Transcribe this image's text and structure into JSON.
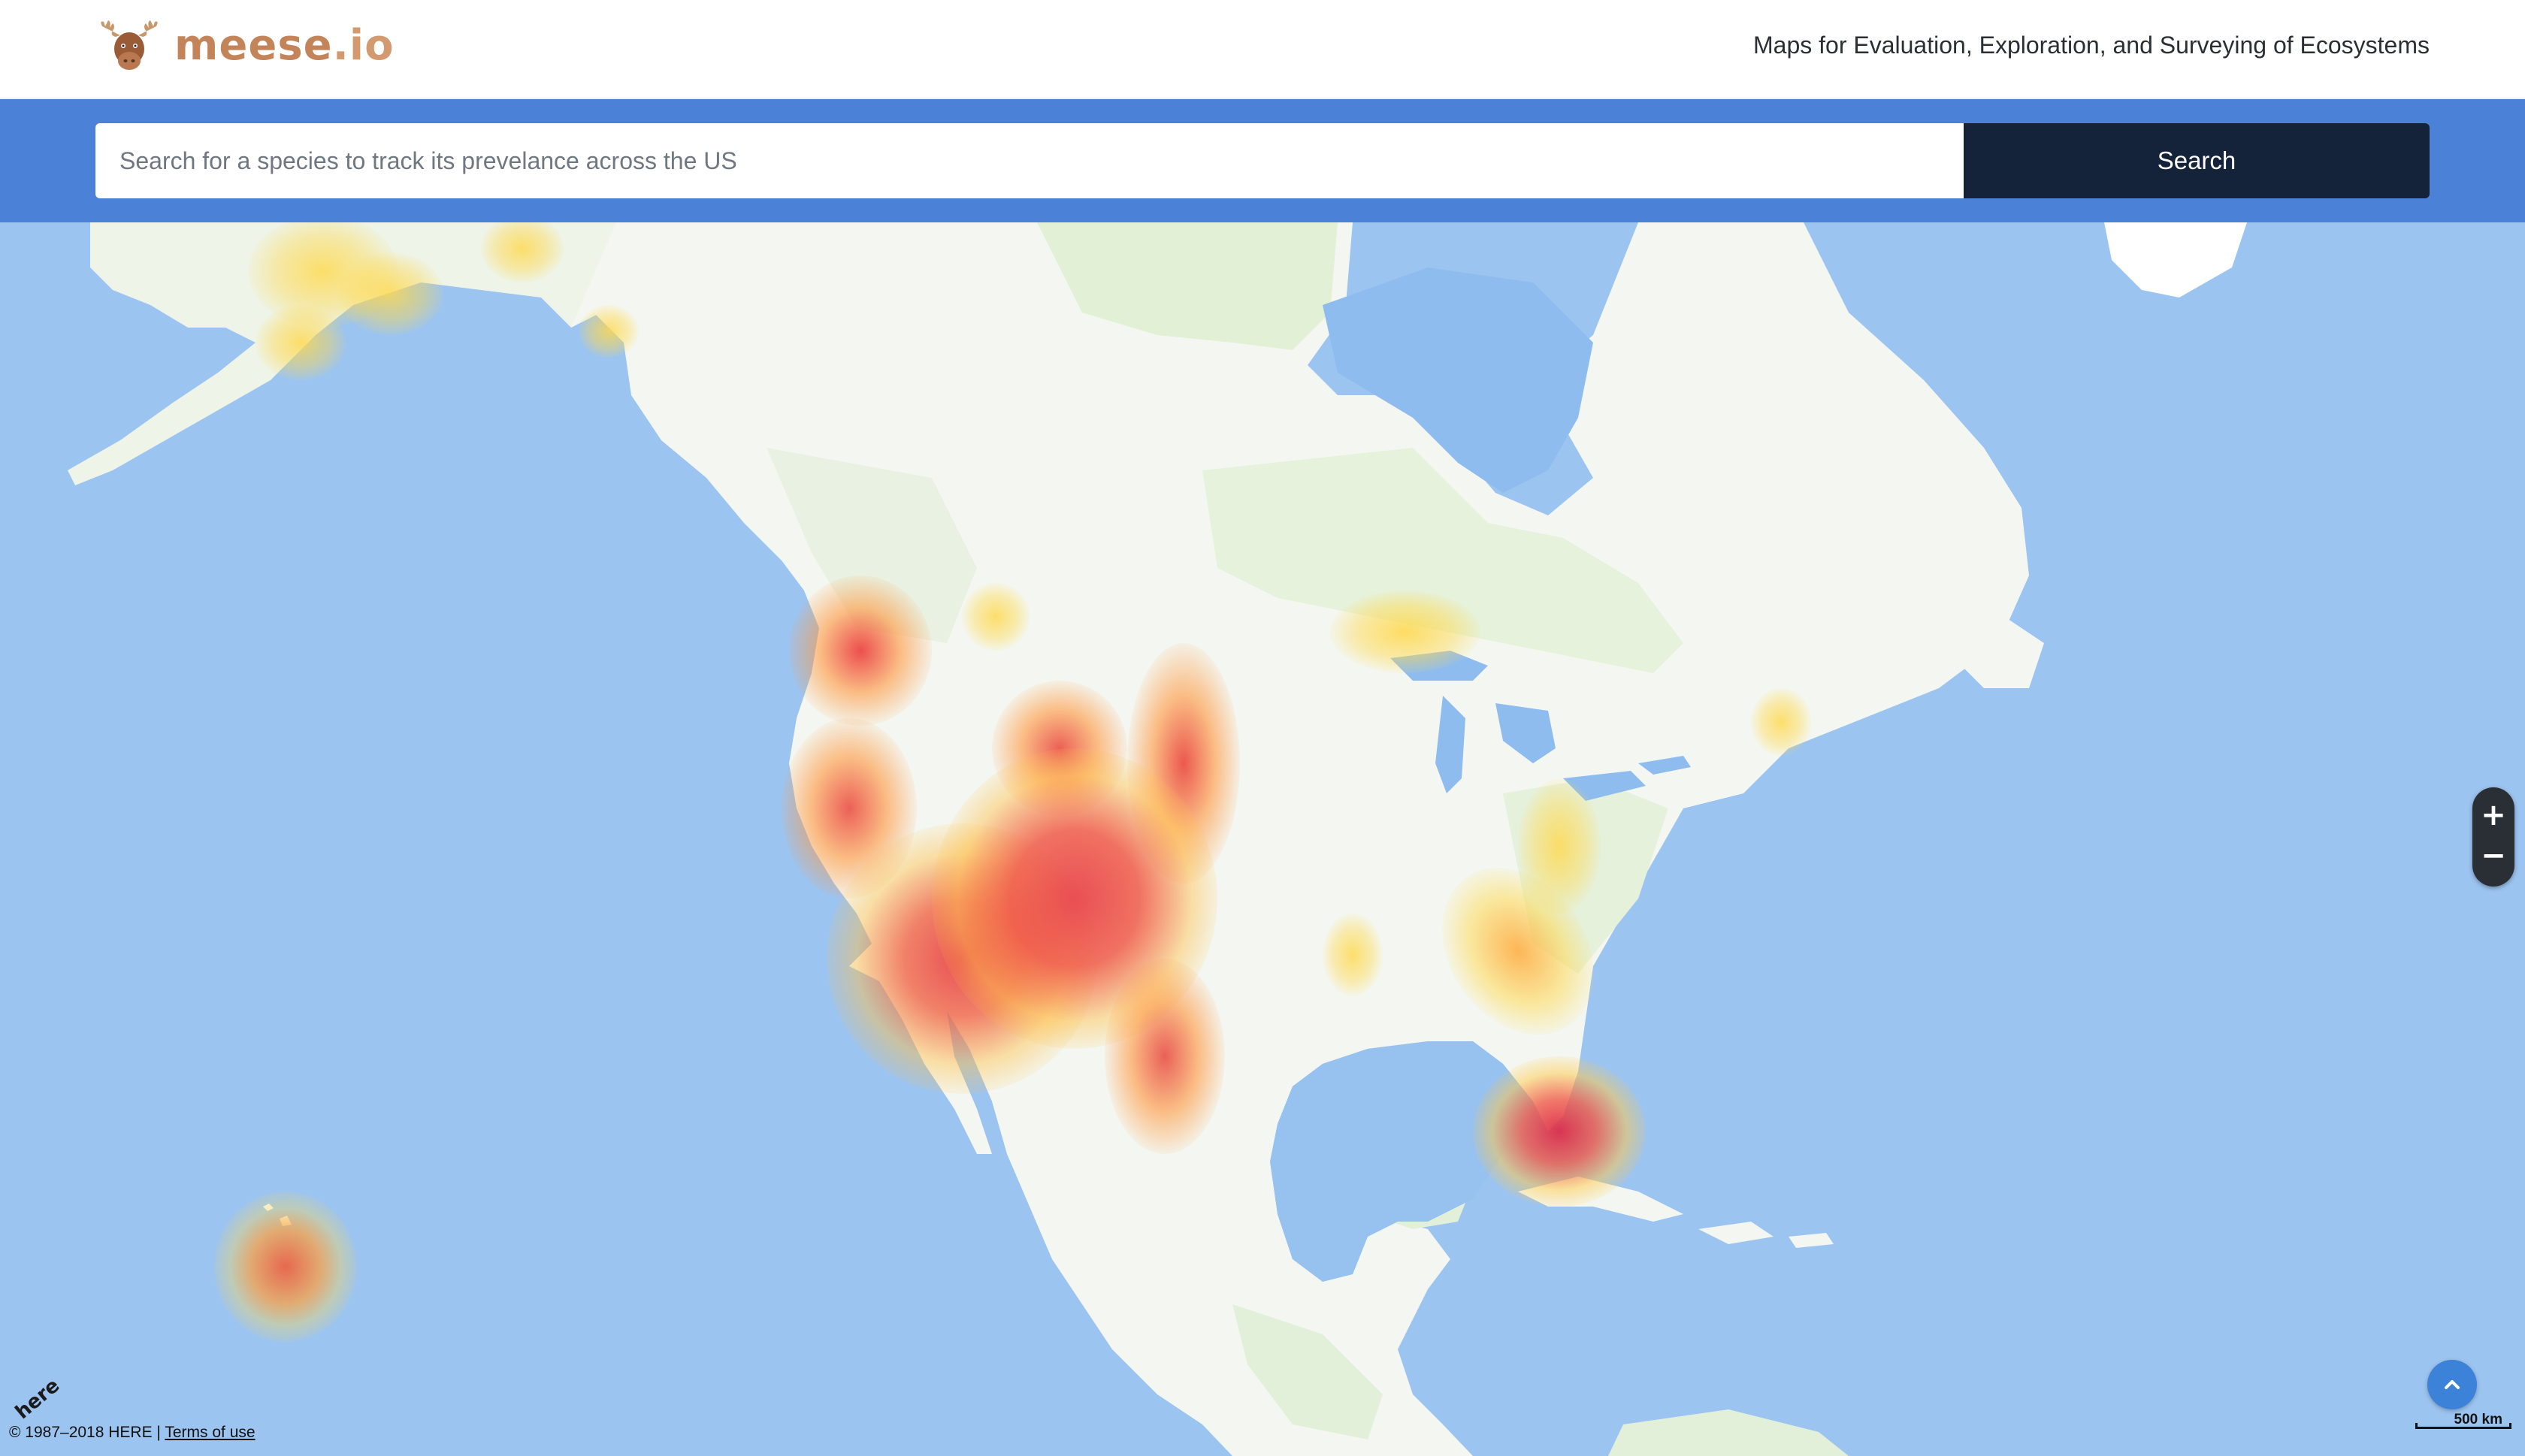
{
  "header": {
    "brand": {
      "name": "meese",
      "tld": ".io",
      "logo_icon": "moose-head-icon"
    },
    "tagline": "Maps for Evaluation, Exploration, and Surveying of Ecosystems"
  },
  "search": {
    "placeholder": "Search for a species to track its prevelance across the US",
    "value": "",
    "button_label": "Search"
  },
  "map": {
    "provider_logo": "here",
    "copyright": "© 1987–2018 HERE | ",
    "terms_label": "Terms of use",
    "scale_label": "500 km",
    "zoom_in_label": "+",
    "zoom_out_label": "−",
    "icons": {
      "scroll_top": "chevron-up-icon",
      "zoom_in": "plus-icon",
      "zoom_out": "minus-icon"
    }
  },
  "colors": {
    "search_bar_bg": "#4b82d8",
    "search_button_bg": "#15233a",
    "brand": "#c4845a",
    "ocean": "#9cc4f0",
    "land": "#f7f9f6",
    "heat_high": "#e8474c",
    "heat_low": "#ffd84a"
  }
}
